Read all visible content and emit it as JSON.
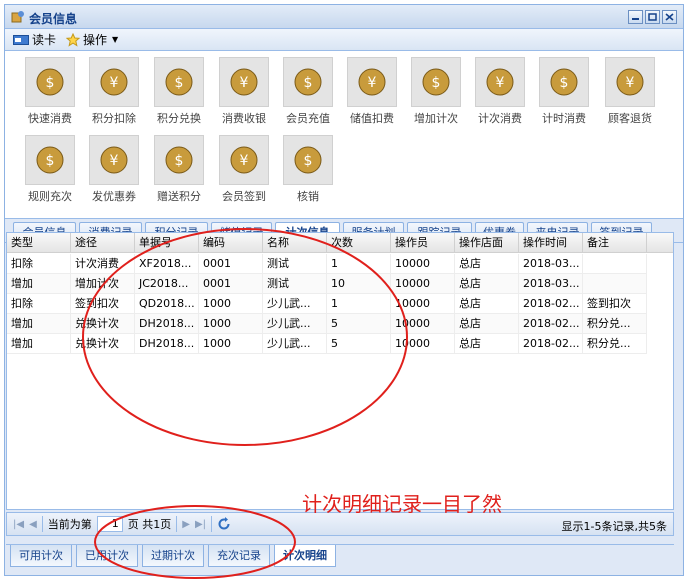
{
  "window": {
    "title": "会员信息"
  },
  "toolbar": {
    "read_card": "读卡",
    "operate": "操作"
  },
  "functions": [
    {
      "label": "快速消费",
      "icon": "money-bag-coins-icon"
    },
    {
      "label": "积分扣除",
      "icon": "coins-minus-icon"
    },
    {
      "label": "积分兑换",
      "icon": "money-bag-exchange-icon"
    },
    {
      "label": "消费收银",
      "icon": "cash-register-icon"
    },
    {
      "label": "会员充值",
      "icon": "yen-plus-icon"
    },
    {
      "label": "储值扣费",
      "icon": "yen-minus-icon"
    },
    {
      "label": "增加计次",
      "icon": "calculator-plus-icon"
    },
    {
      "label": "计次消费",
      "icon": "calculator-icon"
    },
    {
      "label": "计时消费",
      "icon": "clock-icon"
    },
    {
      "label": "顾客退货",
      "icon": "user-return-icon"
    },
    {
      "label": "规则充次",
      "icon": "user-edit-icon"
    },
    {
      "label": "发优惠券",
      "icon": "coupon-icon"
    },
    {
      "label": "赠送积分",
      "icon": "money-bag-gift-icon"
    },
    {
      "label": "会员签到",
      "icon": "calendar-icon"
    },
    {
      "label": "核销",
      "icon": "barcode-icon"
    }
  ],
  "tabs": [
    "会员信息",
    "消费记录",
    "积分记录",
    "储值记录",
    "计次信息",
    "服务计划",
    "跟踪记录",
    "优惠券",
    "来电记录",
    "签到记录"
  ],
  "active_tab": "计次信息",
  "grid": {
    "columns": [
      "类型",
      "途径",
      "单据号",
      "编码",
      "名称",
      "次数",
      "操作员",
      "操作店面",
      "操作时间",
      "备注"
    ],
    "rows": [
      [
        "扣除",
        "计次消费",
        "XF2018...",
        "0001",
        "测试",
        "1",
        "10000",
        "总店",
        "2018-03...",
        ""
      ],
      [
        "增加",
        "增加计次",
        "JC2018...",
        "0001",
        "测试",
        "10",
        "10000",
        "总店",
        "2018-03...",
        ""
      ],
      [
        "扣除",
        "签到扣次",
        "QD2018...",
        "1000",
        "少儿武...",
        "1",
        "10000",
        "总店",
        "2018-02...",
        "签到扣次"
      ],
      [
        "增加",
        "兑换计次",
        "DH2018...",
        "1000",
        "少儿武...",
        "5",
        "10000",
        "总店",
        "2018-02...",
        "积分兑..."
      ],
      [
        "增加",
        "兑换计次",
        "DH2018...",
        "1000",
        "少儿武...",
        "5",
        "10000",
        "总店",
        "2018-02...",
        "积分兑..."
      ]
    ]
  },
  "pager": {
    "current_label": "当前为第",
    "page_value": "1",
    "total_label": "页 共1页",
    "status": "显示1-5条记录,共5条"
  },
  "bottom_tabs": [
    "可用计次",
    "已用计次",
    "过期计次",
    "充次记录",
    "计次明细"
  ],
  "active_bottom_tab": "计次明细",
  "annotation": {
    "text": "计次明细记录一目了然",
    "color": "#e0201c"
  },
  "colors": {
    "border": "#99bbe8",
    "title_text": "#15428b",
    "panel_bg": "#dfe8f6"
  }
}
